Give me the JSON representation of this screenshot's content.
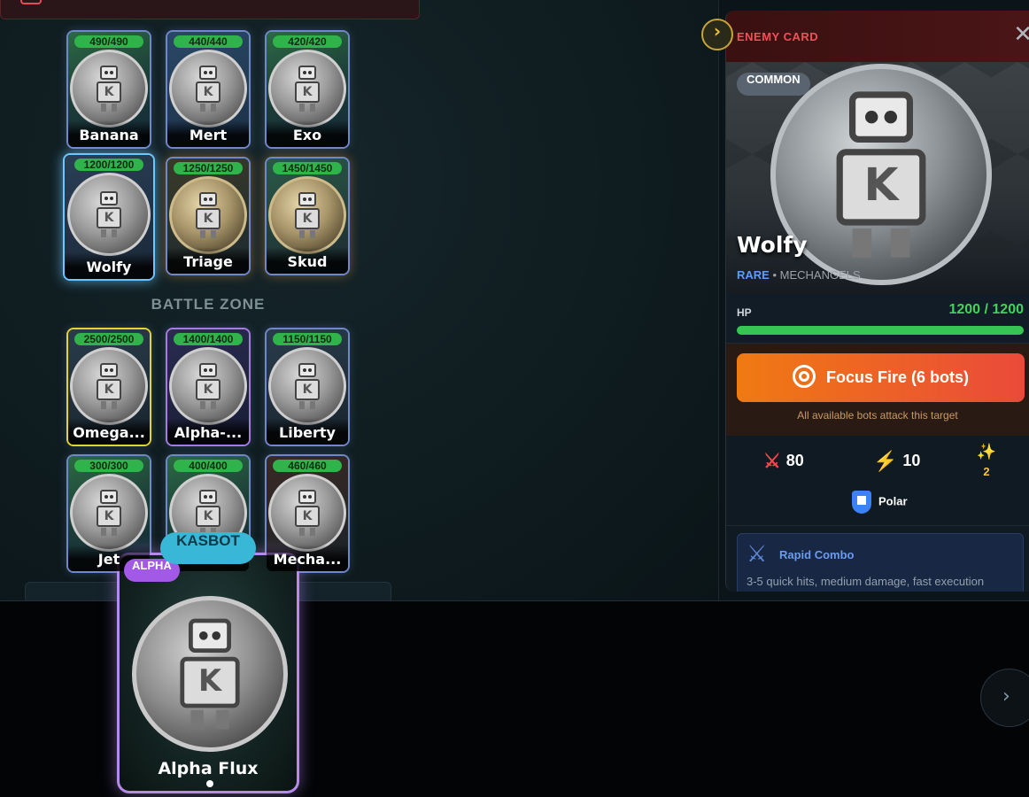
{
  "team_bots": [
    {
      "name": "Banana",
      "hp": "490/490"
    },
    {
      "name": "Mert",
      "hp": "440/440"
    },
    {
      "name": "Exo",
      "hp": "420/420"
    },
    {
      "name": "Wolfy",
      "hp": "1200/1200"
    },
    {
      "name": "Triage",
      "hp": "1250/1250"
    },
    {
      "name": "Skud",
      "hp": "1450/1450"
    }
  ],
  "battle_zone": {
    "label": "BATTLE ZONE",
    "bots": [
      {
        "name": "Omega...",
        "hp": "2500/2500"
      },
      {
        "name": "Alpha-...",
        "hp": "1400/1400"
      },
      {
        "name": "Liberty",
        "hp": "1150/1150"
      },
      {
        "name": "Jet",
        "hp": "300/300"
      },
      {
        "name": "",
        "hp": "400/400"
      },
      {
        "name": "Mecha...",
        "hp": "460/460"
      }
    ]
  },
  "hand": {
    "tag": "KASBOT",
    "badge": "ALPHA",
    "card_name": "Alpha Flux",
    "next_icon": "chevron-right-icon"
  },
  "enemy_panel": {
    "header": "ENEMY CARD",
    "close_icon": "close-icon",
    "collapse_icon": "chevron-right-icon",
    "rarity_pill": "COMMON",
    "name": "Wolfy",
    "rarity": "RARE",
    "faction": "• MECHANGELS",
    "hp_label": "HP",
    "hp_value": "1200 / 1200",
    "hp_fraction": 1.0,
    "focus_button": "Focus Fire (6 bots)",
    "focus_note": "All available bots attack this target",
    "stats": {
      "attack": "80",
      "speed": "10",
      "special": "2",
      "element": "Polar"
    },
    "move": {
      "name": "Rapid Combo",
      "description": "3-5 quick hits, medium damage, fast execution"
    }
  },
  "colors": {
    "hp_green": "#36c552",
    "enemy_red": "#f0505a",
    "alpha_purple": "#a259e6",
    "kasbot_cyan": "#39b7d6",
    "focus_orange": "#f07a12"
  }
}
